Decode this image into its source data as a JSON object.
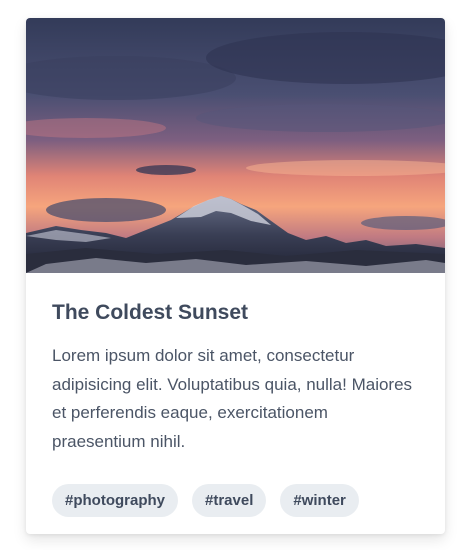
{
  "card": {
    "title": "The Coldest Sunset",
    "description": "Lorem ipsum dolor sit amet, consectetur adipisicing elit. Voluptatibus quia, nulla! Maiores et perferendis eaque, exercitationem praesentium nihil.",
    "image_icon": "mountain-sunset-photo",
    "tags": [
      {
        "label": "#photography"
      },
      {
        "label": "#travel"
      },
      {
        "label": "#winter"
      }
    ]
  },
  "colors": {
    "title": "#3f4a5d",
    "text": "#4b5566",
    "tag_background": "#e9edf1",
    "sky_top": "#3b4362",
    "sunset": "#f08a73"
  }
}
